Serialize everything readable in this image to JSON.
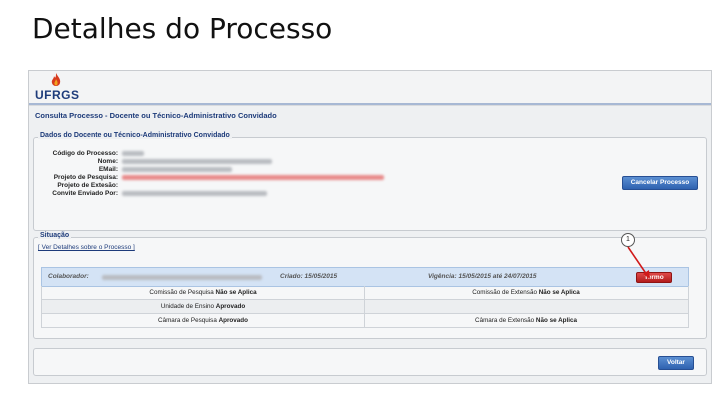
{
  "slide_title": "Detalhes do Processo",
  "app": {
    "logo_text": "UFRGS",
    "page_heading": "Consulta Processo - Docente ou Técnico-Administrativo Convidado"
  },
  "dados": {
    "legend": "Dados do Docente ou Técnico-Administrativo Convidado",
    "fields": [
      {
        "label": "Código do Processo:"
      },
      {
        "label": "Nome:"
      },
      {
        "label": "EMail:"
      },
      {
        "label": "Projeto de Pesquisa:"
      },
      {
        "label": "Projeto de Extesão:"
      },
      {
        "label": "Convite Enviado Por:"
      }
    ],
    "cancel_button": "Cancelar Processo"
  },
  "situacao": {
    "legend": "Situação",
    "details_link": "[ Ver Detalhes sobre o Processo ]",
    "header": {
      "colaborador_label": "Colaborador:",
      "criado": "Criado: 15/05/2015",
      "vigencia": "Vigência: 15/05/2015 até 24/07/2015",
      "termo_button": "Termo"
    },
    "rows": [
      {
        "left_label": "Comissão de Pesquisa",
        "left_status": "Não se Aplica",
        "right_label": "Comissão de Extensão",
        "right_status": "Não se Aplica"
      },
      {
        "left_label": "Unidade de Ensino",
        "left_status": "Aprovado",
        "right_label": "",
        "right_status": ""
      },
      {
        "left_label": "Câmara de Pesquisa",
        "left_status": "Aprovado",
        "right_label": "Câmara de Extensão",
        "right_status": "Não se Aplica"
      }
    ],
    "callout_number": "1"
  },
  "footer": {
    "back_button": "Voltar"
  },
  "colors": {
    "brand_blue": "#1d3b7a",
    "button_blue": "#2f62b0",
    "termo_red": "#c42626",
    "annotation_red": "#d11a1a"
  }
}
